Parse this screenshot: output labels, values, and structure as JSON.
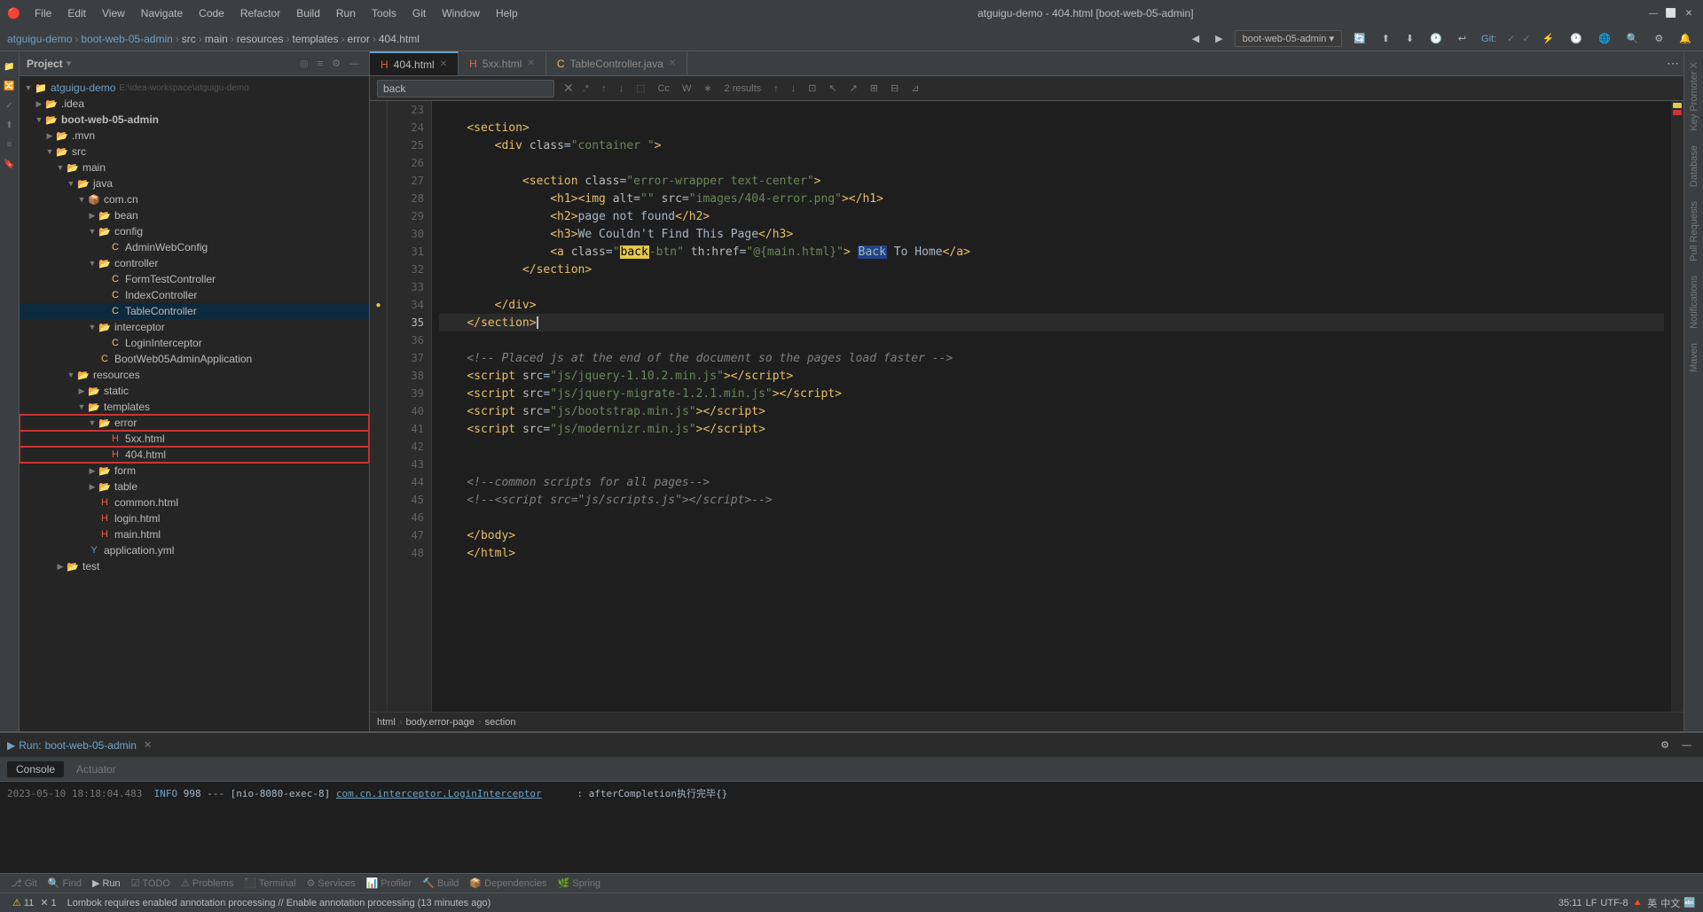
{
  "titleBar": {
    "logo": "🔴",
    "menus": [
      "File",
      "Edit",
      "View",
      "Navigate",
      "Code",
      "Refactor",
      "Build",
      "Run",
      "Tools",
      "Git",
      "Window",
      "Help"
    ],
    "title": "atguigu-demo - 404.html [boot-web-05-admin]",
    "windowControls": [
      "—",
      "⬜",
      "✕"
    ]
  },
  "breadcrumb": {
    "items": [
      "atguigu-demo",
      "boot-web-05-admin",
      "src",
      "main",
      "resources",
      "templates",
      "error",
      "404.html"
    ]
  },
  "tabs": [
    {
      "label": "404.html",
      "active": true,
      "modified": false
    },
    {
      "label": "5xx.html",
      "active": false,
      "modified": false
    },
    {
      "label": "TableController.java",
      "active": false,
      "modified": false
    }
  ],
  "search": {
    "query": "back",
    "results": "2 results",
    "placeholder": "back"
  },
  "codeLines": [
    {
      "num": 23,
      "content": ""
    },
    {
      "num": 24,
      "content": "    <section>"
    },
    {
      "num": 25,
      "content": "        <div class=\"container \">"
    },
    {
      "num": 26,
      "content": ""
    },
    {
      "num": 27,
      "content": "            <section class=\"error-wrapper text-center\">"
    },
    {
      "num": 28,
      "content": "                <h1><img alt=\"\" src=\"images/404-error.png\"></h1>"
    },
    {
      "num": 29,
      "content": "                <h2>page not found</h2>"
    },
    {
      "num": 30,
      "content": "                <h3>We Couldn't Find This Page</h3>"
    },
    {
      "num": 31,
      "content": "                <a class=\"back-btn\" th:href=\"@{main.html}\"> Back To Home</a>",
      "hasHighlight": true
    },
    {
      "num": 32,
      "content": "            </section>"
    },
    {
      "num": 33,
      "content": ""
    },
    {
      "num": 34,
      "content": "        </div>",
      "hasWarning": true
    },
    {
      "num": 35,
      "content": "    </section>",
      "isCurrent": true
    },
    {
      "num": 36,
      "content": ""
    },
    {
      "num": 37,
      "content": "    <!-- Placed js at the end of the document so the pages load faster -->"
    },
    {
      "num": 38,
      "content": "    <script src=\"js/jquery-1.10.2.min.js\"></script>"
    },
    {
      "num": 39,
      "content": "    <script src=\"js/jquery-migrate-1.2.1.min.js\"></script>"
    },
    {
      "num": 40,
      "content": "    <script src=\"js/bootstrap.min.js\"></script>"
    },
    {
      "num": 41,
      "content": "    <script src=\"js/modernizr.min.js\"></script>"
    },
    {
      "num": 42,
      "content": ""
    },
    {
      "num": 43,
      "content": ""
    },
    {
      "num": 44,
      "content": "    <!--common scripts for all pages-->"
    },
    {
      "num": 45,
      "content": "    <!--<script src=\"js/scripts.js\"></script>-->"
    },
    {
      "num": 46,
      "content": ""
    },
    {
      "num": 47,
      "content": "    </body>"
    },
    {
      "num": 48,
      "content": "    </html>"
    }
  ],
  "editorBreadcrumb": [
    "html",
    "body.error-page",
    "section"
  ],
  "projectPanel": {
    "title": "Project",
    "tree": [
      {
        "id": "atguigu-demo",
        "label": "atguigu-demo",
        "type": "project",
        "indent": 0,
        "expanded": true,
        "path": "E:\\idea-workspace\\atguigu-demo"
      },
      {
        "id": "idea",
        "label": ".idea",
        "type": "folder",
        "indent": 1,
        "expanded": false
      },
      {
        "id": "boot-web-05-admin",
        "label": "boot-web-05-admin",
        "type": "module",
        "indent": 1,
        "expanded": true
      },
      {
        "id": "mvn",
        "label": ".mvn",
        "type": "folder",
        "indent": 2,
        "expanded": false
      },
      {
        "id": "src",
        "label": "src",
        "type": "folder",
        "indent": 2,
        "expanded": true
      },
      {
        "id": "main",
        "label": "main",
        "type": "folder",
        "indent": 3,
        "expanded": true
      },
      {
        "id": "java",
        "label": "java",
        "type": "folder",
        "indent": 4,
        "expanded": true
      },
      {
        "id": "com.cn",
        "label": "com.cn",
        "type": "package",
        "indent": 5,
        "expanded": true
      },
      {
        "id": "bean",
        "label": "bean",
        "type": "folder",
        "indent": 6,
        "expanded": false
      },
      {
        "id": "config",
        "label": "config",
        "type": "folder",
        "indent": 6,
        "expanded": true
      },
      {
        "id": "AdminWebConfig",
        "label": "AdminWebConfig",
        "type": "java",
        "indent": 7
      },
      {
        "id": "controller",
        "label": "controller",
        "type": "folder",
        "indent": 6,
        "expanded": true
      },
      {
        "id": "FormTestController",
        "label": "FormTestController",
        "type": "java",
        "indent": 7
      },
      {
        "id": "IndexController",
        "label": "IndexController",
        "type": "java",
        "indent": 7
      },
      {
        "id": "TableController",
        "label": "TableController",
        "type": "java",
        "indent": 7,
        "selected": true
      },
      {
        "id": "interceptor",
        "label": "interceptor",
        "type": "folder",
        "indent": 6,
        "expanded": true
      },
      {
        "id": "LoginInterceptor",
        "label": "LoginInterceptor",
        "type": "java",
        "indent": 7
      },
      {
        "id": "BootWeb05AdminApplication",
        "label": "BootWeb05AdminApplication",
        "type": "java",
        "indent": 7
      },
      {
        "id": "resources",
        "label": "resources",
        "type": "folder",
        "indent": 4,
        "expanded": true
      },
      {
        "id": "static",
        "label": "static",
        "type": "folder",
        "indent": 5,
        "expanded": false
      },
      {
        "id": "templates",
        "label": "templates",
        "type": "folder",
        "indent": 5,
        "expanded": true
      },
      {
        "id": "error",
        "label": "error",
        "type": "folder",
        "indent": 6,
        "expanded": true,
        "highlighted": true
      },
      {
        "id": "5xx.html",
        "label": "5xx.html",
        "type": "html",
        "indent": 7,
        "highlighted": true
      },
      {
        "id": "404.html",
        "label": "404.html",
        "type": "html",
        "indent": 7,
        "highlighted": true
      },
      {
        "id": "form",
        "label": "form",
        "type": "folder",
        "indent": 6,
        "expanded": false
      },
      {
        "id": "table",
        "label": "table",
        "type": "folder",
        "indent": 6,
        "expanded": false
      },
      {
        "id": "common.html",
        "label": "common.html",
        "type": "html",
        "indent": 6
      },
      {
        "id": "login.html",
        "label": "login.html",
        "type": "html",
        "indent": 6
      },
      {
        "id": "main.html",
        "label": "main.html",
        "type": "html",
        "indent": 6
      },
      {
        "id": "application.yml",
        "label": "application.yml",
        "type": "yaml",
        "indent": 5
      },
      {
        "id": "test",
        "label": "test",
        "type": "folder",
        "indent": 3,
        "expanded": false
      }
    ]
  },
  "runBar": {
    "label": "Run:",
    "appName": "boot-web-05-admin",
    "closeLabel": "✕"
  },
  "bottomTabs": [
    {
      "label": "Console",
      "active": true
    },
    {
      "label": "Actuator",
      "active": false
    }
  ],
  "consoleLine": "2023-05-10 18:18:04.483  INFO 998 --- [nio-8080-exec-8] com.cn.interceptor.LoginInterceptor      : afterCompletion执行完毕{}",
  "bottomToolTabs": [
    {
      "label": "Git",
      "icon": "⎇"
    },
    {
      "label": "Find",
      "icon": "🔍"
    },
    {
      "label": "Run",
      "icon": "▶",
      "active": true
    },
    {
      "label": "TODO",
      "icon": "☑"
    },
    {
      "label": "Problems",
      "icon": "⚠"
    },
    {
      "label": "Terminal",
      "icon": "⬛"
    },
    {
      "label": "Services",
      "icon": "⚙"
    },
    {
      "label": "Profiler",
      "icon": "📊"
    },
    {
      "label": "Build",
      "icon": "🔨"
    },
    {
      "label": "Dependencies",
      "icon": "📦"
    },
    {
      "label": "Spring",
      "icon": "🌿"
    }
  ],
  "statusBar": {
    "position": "35:11",
    "lineEnding": "LF",
    "encoding": "UTF-8",
    "warnings": "⚠ 11",
    "errors": "✕ 1"
  },
  "bottomStatusBar": {
    "message": "Lombok requires enabled annotation processing // Enable annotation processing (13 minutes ago)"
  },
  "rightSidebarLabels": [
    "Key Promoter X",
    "Database",
    "Pull Requests",
    "Notifications",
    "Maven"
  ]
}
